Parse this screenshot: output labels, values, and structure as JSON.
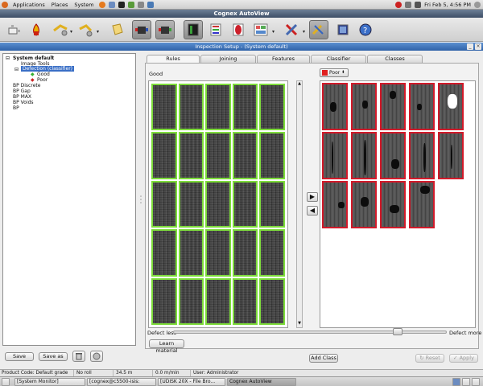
{
  "gnome_panel": {
    "menus": [
      "Applications",
      "Places",
      "System"
    ],
    "clock": "Fri Feb  5,  4:56 PM"
  },
  "app": {
    "title": "Cognex AutoView"
  },
  "toolbar": {
    "buttons": [
      "camera-icon",
      "fire-icon",
      "gear-arrow-icon",
      "gear-arrow-icon",
      "document-icon",
      "cylinder-icon",
      "cylinder-icon",
      "monitor-icon",
      "list-icon",
      "circle-badge-icon",
      "layout-icon",
      "tools-icon",
      "draw-icon",
      "frame-icon",
      "help-icon"
    ]
  },
  "dialog": {
    "title": "Inspection Setup - (System default)"
  },
  "tree": {
    "root": "System default",
    "items": [
      {
        "label": "Image Tools",
        "level": 1
      },
      {
        "label": "Defection (classifier)",
        "level": 1,
        "selected": true
      },
      {
        "label": "Good",
        "level": 2,
        "marker": "#35b031"
      },
      {
        "label": "Poor",
        "level": 2,
        "marker": "#cc2222"
      },
      {
        "label": "BP Discrete",
        "level": 0
      },
      {
        "label": "BP Gap",
        "level": 0
      },
      {
        "label": "BP MAX",
        "level": 0
      },
      {
        "label": "BP Voids",
        "level": 0
      },
      {
        "label": "BP",
        "level": 0
      }
    ]
  },
  "tabs": [
    "Rules",
    "Joining",
    "Features",
    "Classifier",
    "Classes"
  ],
  "active_tab": "Rules",
  "good_panel": {
    "label": "Good",
    "rows": 5,
    "cols": 5,
    "border_color": "#7ddc3a"
  },
  "poor_panel": {
    "dropdown": "Poor",
    "swatch_color": "#e02020",
    "count": 14,
    "border_color": "#d21a2a"
  },
  "arrows": {
    "right": "▶",
    "left": "◀"
  },
  "slider": {
    "left_label": "Defect less",
    "right_label": "Defect more",
    "value": 0.82
  },
  "buttons": {
    "learn": "Learn material",
    "save": "Save",
    "save_as": "Save as",
    "add_class": "Add Class",
    "reset": "Reset",
    "apply": "Apply"
  },
  "status": {
    "product_code": "Product Code: Default grade",
    "roll": "No roll",
    "length": "34.5 m",
    "speed": "0.0 m/min",
    "user": "User: Administrator"
  },
  "taskbar": [
    "[System Monitor]",
    "[cognex@c5500-isis:",
    "[UDISK 20X - File Bro...",
    "Cognex AutoView"
  ],
  "taskbar_active": 3
}
